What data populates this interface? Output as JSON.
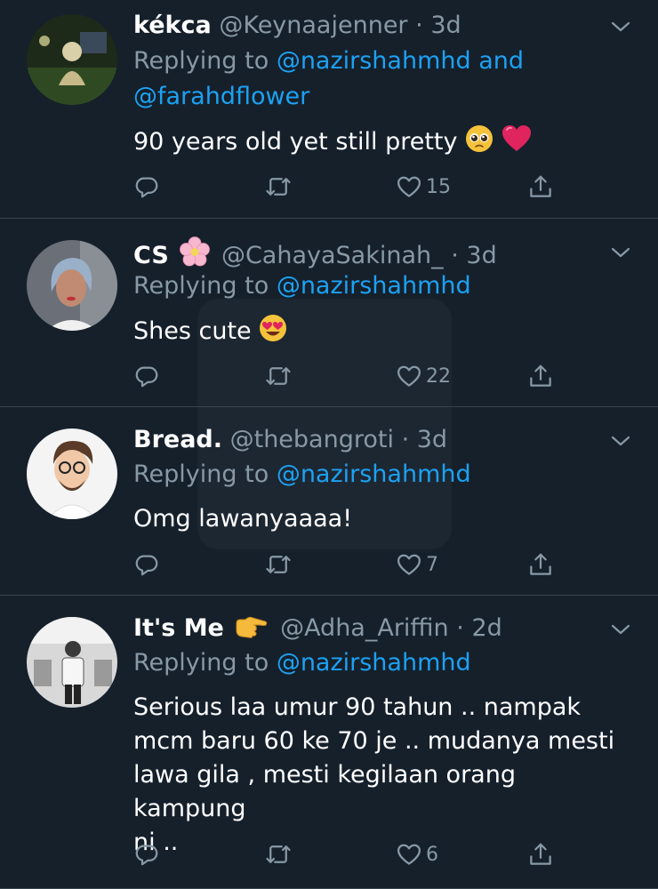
{
  "tweets": [
    {
      "name": "kékca",
      "handle": "@Keynaajenner",
      "time": "3d",
      "replying_prefix": "Replying to ",
      "mention1": "@nazirshahmhd",
      "mention_joiner": " and",
      "mention2": "@farahdflower",
      "text": "90 years old yet still pretty",
      "likes": "15"
    },
    {
      "name": "CS",
      "handle": "@CahayaSakinah_",
      "time": "3d",
      "replying_prefix": "Replying to ",
      "mention1": "@nazirshahmhd",
      "text": "Shes cute",
      "likes": "22"
    },
    {
      "name": "Bread.",
      "handle": "@thebangroti",
      "time": "3d",
      "replying_prefix": "Replying to ",
      "mention1": "@nazirshahmhd",
      "text": "Omg lawanyaaaa!",
      "likes": "7"
    },
    {
      "name": "It's Me",
      "handle": "@Adha_Ariffin",
      "time": "2d",
      "replying_prefix": "Replying to ",
      "mention1": "@nazirshahmhd",
      "text_lines": [
        "Serious laa umur 90 tahun .. nampak",
        "mcm baru 60 ke 70 je .. mudanya mesti",
        "lawa gila , mesti kegilaan orang kampung",
        "ni .."
      ],
      "likes": "6"
    }
  ],
  "dot": "·",
  "icons": [
    "reply-icon",
    "retweet-icon",
    "like-icon",
    "share-icon",
    "chevron-down-icon"
  ],
  "colors": {
    "background": "#15202b",
    "secondary_text": "#8899a6",
    "link": "#1da1f2",
    "divider": "#38444d"
  }
}
